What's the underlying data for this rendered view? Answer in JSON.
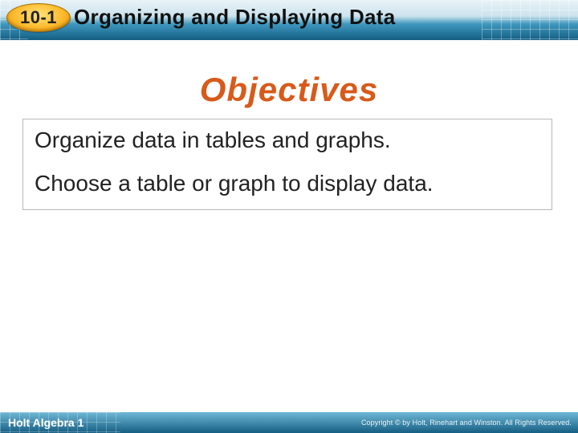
{
  "header": {
    "lesson_number": "10-1",
    "title": "Organizing and Displaying Data"
  },
  "objectives": {
    "heading": "Objectives",
    "items": [
      "Organize data in tables and graphs.",
      "Choose a table or graph to display data."
    ]
  },
  "footer": {
    "book": "Holt Algebra 1",
    "copyright": "Copyright © by Holt, Rinehart and Winston. All Rights Reserved."
  }
}
